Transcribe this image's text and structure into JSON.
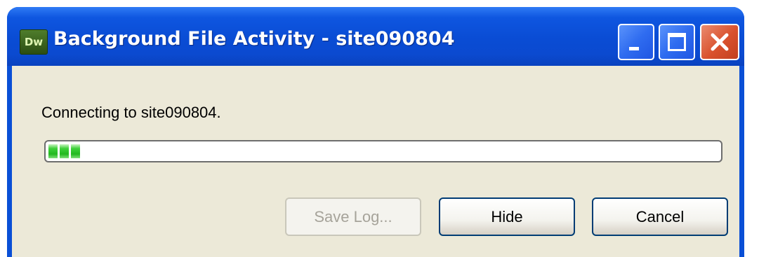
{
  "window": {
    "app_icon_text": "Dw",
    "title": "Background File Activity - site090804"
  },
  "status": {
    "message": "Connecting to site090804."
  },
  "progress": {
    "filled_segments": 3
  },
  "buttons": {
    "save_log": "Save Log...",
    "hide": "Hide",
    "cancel": "Cancel"
  },
  "colors": {
    "titlebar": "#0a4cd4",
    "close_button": "#d9512d",
    "client_background": "#ece9d8",
    "progress_green": "#22b81f"
  }
}
